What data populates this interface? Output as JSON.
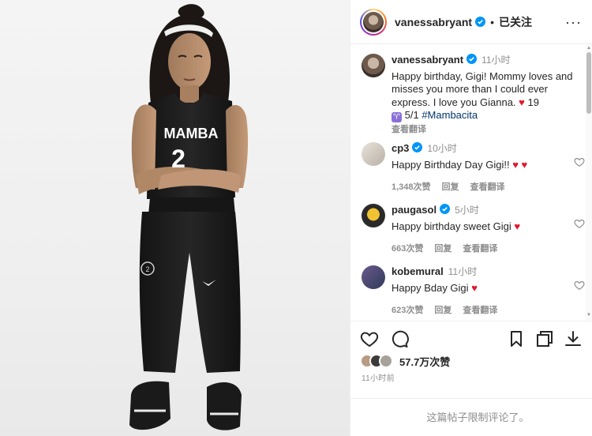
{
  "post": {
    "author": "vanessabryant",
    "follow_status": "已关注",
    "more": "···",
    "photo_alt": "young basketball player in MAMBA jersey number 2"
  },
  "jersey": {
    "team": "MAMBA",
    "number": "2"
  },
  "comments": [
    {
      "user": "vanessabryant",
      "time": "11小时",
      "text": "Happy birthday, Gigi! Mommy loves and misses you more than I could ever express. I love you Gianna.",
      "heart": "♥",
      "tail": "19",
      "aries": "♈",
      "tail2": "5/1",
      "hashtag": "#Mambacita",
      "translate": "查看翻译"
    },
    {
      "user": "cp3",
      "time": "10小时",
      "text": "Happy Birthday Day Gigi!!",
      "hearts": "♥ ♥",
      "likes": "1,348次赞",
      "reply": "回复",
      "translate": "查看翻译"
    },
    {
      "user": "paugasol",
      "time": "5小时",
      "text": "Happy birthday sweet Gigi",
      "hearts": "♥",
      "likes": "663次赞",
      "reply": "回复",
      "translate": "查看翻译"
    },
    {
      "user": "kobemural",
      "time": "11小时",
      "text": "Happy Bday Gigi",
      "hearts": "♥",
      "likes": "623次赞",
      "reply": "回复",
      "translate": "查看翻译"
    }
  ],
  "stats": {
    "likes": "57.7万次赞",
    "posted": "11小时前"
  },
  "footer": {
    "limited": "这篇帖子限制评论了。"
  },
  "icons": [
    "more-icon",
    "verified-icon",
    "heart-icon",
    "comment-icon",
    "share-icon",
    "save-icon",
    "screenshot-icon",
    "download-icon"
  ],
  "colors": {
    "accent_blue": "#0095f6",
    "heart_red": "#e0182d",
    "muted": "#8e8e8e",
    "hashtag": "#00376b"
  }
}
